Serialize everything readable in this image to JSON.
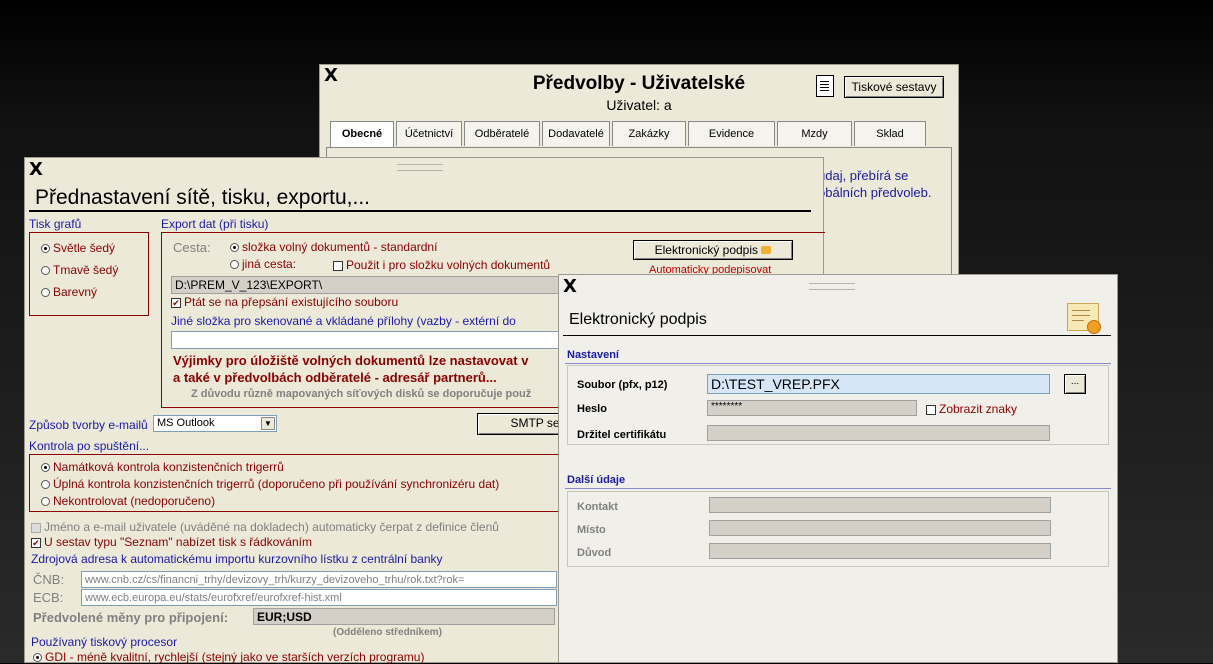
{
  "predvolby": {
    "close": "X",
    "title": "Předvolby - Uživatelské",
    "subtitle": "Uživatel: a",
    "print_button": "Tiskové sestavy",
    "tabs": [
      "Obecné",
      "Účetnictví",
      "Odběratelé",
      "Dodavatelé",
      "Zakázky",
      "Evidence",
      "Mzdy",
      "Sklad"
    ],
    "info_line1": "údaj, přebírá se",
    "info_line2": "obálních předvoleb."
  },
  "prednastaveni": {
    "close": "X",
    "title": "Přednastavení sítě, tisku, exportu,...",
    "tisk_grafu": "Tisk grafů",
    "grafy_options": [
      "Světle šedý",
      "Tmavě šedý",
      "Barevný"
    ],
    "export_label": "Export dat (při tisku)",
    "cesta_label": "Cesta:",
    "cesta_opt1": "složka volný dokumentů - standardní",
    "cesta_opt2": "jiná cesta:",
    "pouzit_chk": "Použit i pro složku volných dokumentů",
    "path_value": "D:\\PREM_V_123\\EXPORT\\",
    "ptat_chk": "Ptát se na přepsání existujícího souboru",
    "jine_slozka": "Jiné složka pro skenované a vkládané přílohy (vazby - extérní do",
    "el_podpis_btn": "Elektronický podpis",
    "auto_podepisovat": "Automaticky podepisovat",
    "vyjimky_line1": "Výjimky pro úložiště volných dokumentů lze nastavovat v",
    "vyjimky_line2": "a také v předvolbách odběratelé - adresář partnerů...",
    "duvodu_line": "Z důvodu různě mapovaných síťových disků se doporučuje použ",
    "zpusob_email_label": "Způsob tvorby e-mailů",
    "email_select": "MS Outlook",
    "smtp_btn": "SMTP ser",
    "kontrola_label": "Kontrola po spuštění...",
    "kontrola_options": [
      "Namátková kontrola konzistenčních trigerrů",
      "Úplná kontrola konzistenčních trigerrů (doporučeno při používání synchronizéru dat)",
      "Nekontrolovat (nedoporučeno)"
    ],
    "jmeno_chk": "Jméno a e-mail uživatele (uváděné na dokladech) automaticky čerpat z definice členů",
    "seznam_chk": "U sestav typu \"Seznam\" nabízet tisk s řádkováním",
    "zdrojova_label": "Zdrojová adresa k automatickému importu kurzovního lístku z centrální banky",
    "cnb_label": "ČNB:",
    "cnb_value": "www.cnb.cz/cs/financni_trhy/devizovy_trh/kurzy_devizoveho_trhu/rok.txt?rok=",
    "ecb_label": "ECB:",
    "ecb_value": "www.ecb.europa.eu/stats/eurofxref/eurofxref-hist.xml",
    "meny_label": "Předvolené měny pro připojení:",
    "meny_value": "EUR;USD",
    "oddeleno": "(Odděleno středníkem)",
    "tiskovy_label": "Používaný tiskový procesor",
    "gdi_option": "GDI - méně kvalitní, rychlejší (stejný jako ve starších verzích programu)"
  },
  "podpis": {
    "close": "X",
    "title": "Elektronický podpis",
    "nastaveni": "Nastavení",
    "soubor_label": "Soubor (pfx, p12)",
    "soubor_value": "D:\\TEST_VREP.PFX",
    "browse": "...",
    "heslo_label": "Heslo",
    "heslo_value": "********",
    "zobrazit_chk": "Zobrazit znaky",
    "drzitel_label": "Držitel certifikátu",
    "dalsi": "Další údaje",
    "kontakt_label": "Kontakt",
    "misto_label": "Místo",
    "duvod_label": "Důvod"
  }
}
